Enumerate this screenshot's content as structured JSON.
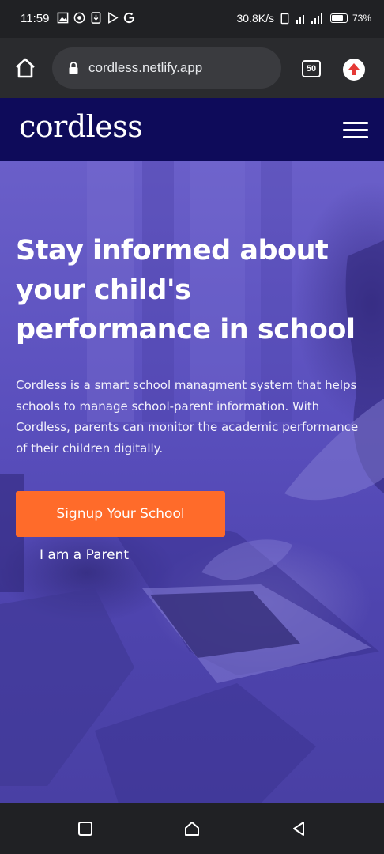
{
  "status_bar": {
    "time": "11:59",
    "network_speed": "30.8K/s",
    "battery": "73%",
    "icons": [
      "gallery-icon",
      "circle-icon",
      "download-icon",
      "play-store-icon",
      "google-icon",
      "vibrate-icon",
      "signal-icon",
      "battery-icon"
    ]
  },
  "browser": {
    "url": "cordless.netlify.app",
    "tab_count": "50",
    "icons": [
      "home-icon",
      "lock-icon",
      "tabs-icon",
      "update-icon"
    ]
  },
  "site_header": {
    "logo": "cordless",
    "menu_icon": "hamburger-menu-icon"
  },
  "hero": {
    "title": "Stay informed about your child's performance in school",
    "description": "Cordless is a smart school managment system that helps schools to manage school-parent information. With Cordless, parents can monitor the academic performance of their children digitally.",
    "primary_button": "Signup Your School",
    "secondary_link": "I am a Parent"
  },
  "colors": {
    "header_bg": "#0e0b5a",
    "hero_overlay": "#5a4fbd",
    "cta": "#ff6b2a"
  },
  "nav_bar": {
    "icons": [
      "recents-icon",
      "home-icon",
      "back-icon"
    ]
  }
}
